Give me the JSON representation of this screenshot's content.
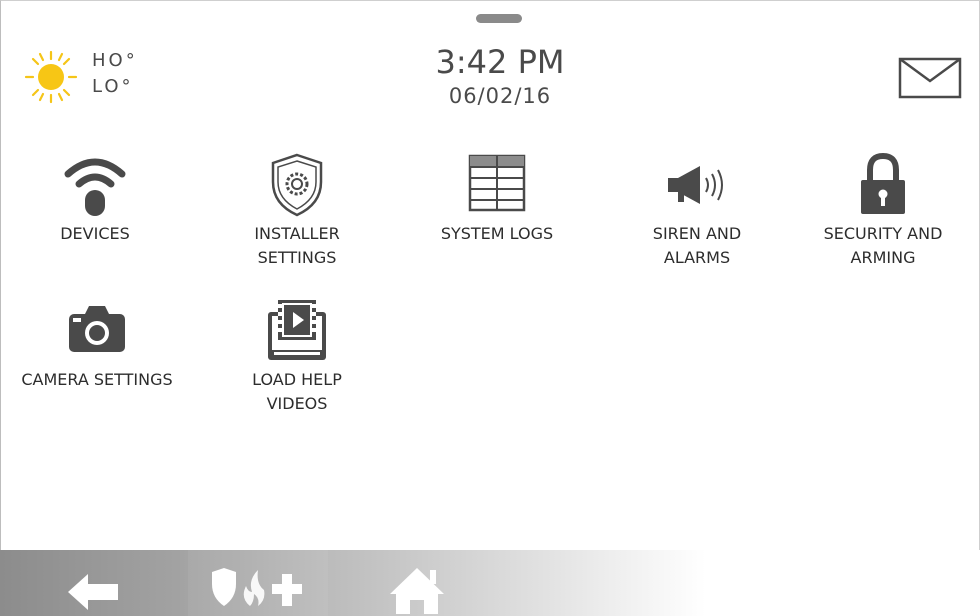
{
  "status": {
    "weather": {
      "icon": "sun-icon",
      "high": "HO°",
      "low": "LO°"
    },
    "time": "3:42 PM",
    "date": "06/02/16",
    "messages_icon": "envelope-icon"
  },
  "tiles": [
    {
      "label": "DEVICES",
      "icon": "wifi-remote-icon"
    },
    {
      "label": "INSTALLER\nSETTINGS",
      "icon": "shield-gear-icon"
    },
    {
      "label": "SYSTEM LOGS",
      "icon": "table-log-icon"
    },
    {
      "label": "SIREN AND\nALARMS",
      "icon": "megaphone-icon"
    },
    {
      "label": "SECURITY AND\nARMING",
      "icon": "padlock-icon"
    },
    {
      "label": "CAMERA SETTINGS",
      "icon": "camera-icon"
    },
    {
      "label": "LOAD HELP\nVIDEOS",
      "icon": "video-tablet-icon"
    }
  ],
  "navbar": {
    "back_icon": "back-arrow-icon",
    "emergency_icons": [
      "shield-icon",
      "fire-icon",
      "medical-cross-icon"
    ],
    "home_icon": "home-icon"
  },
  "colors": {
    "icon": "#4a4a4a",
    "sun": "#f5c518",
    "navbar_start": "#8c8c8c"
  }
}
